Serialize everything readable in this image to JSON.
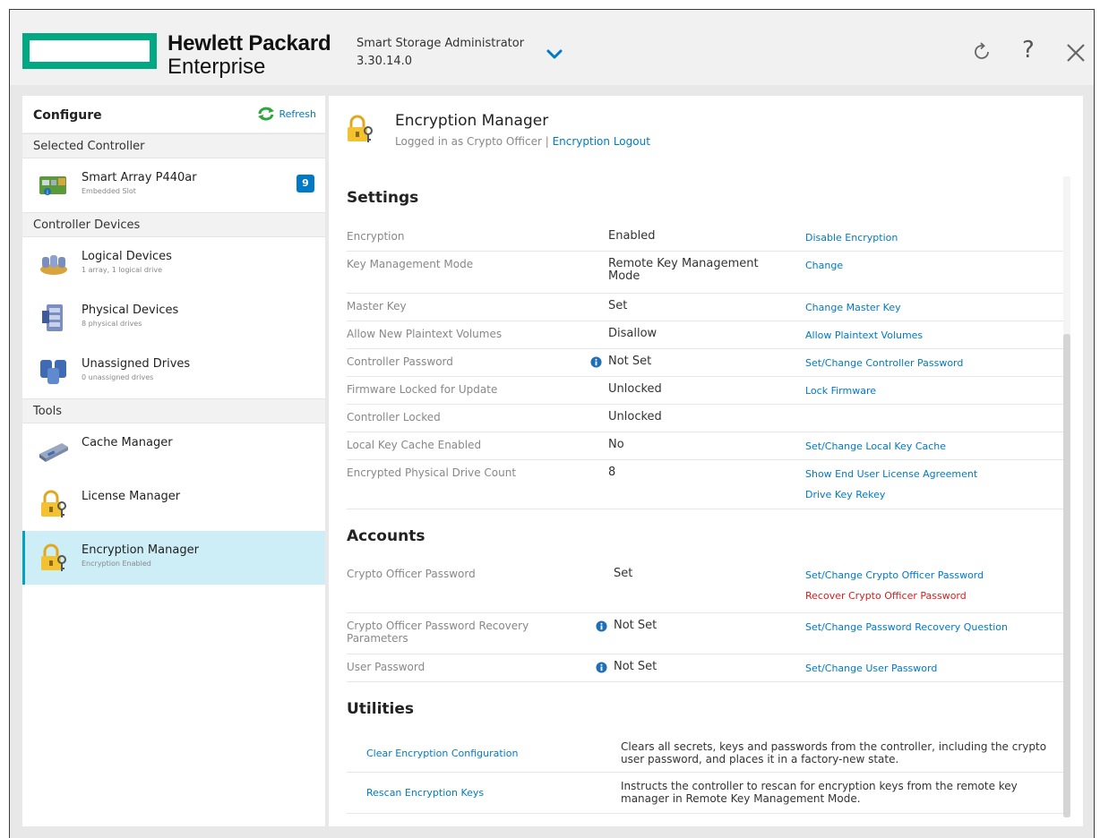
{
  "header": {
    "brand_line1": "Hewlett Packard",
    "brand_line2": "Enterprise",
    "app_name": "Smart Storage Administrator",
    "app_version": "3.30.14.0",
    "help_glyph": "?"
  },
  "colors": {
    "brand_green": "#01a982",
    "link_blue": "#0079c7",
    "danger_red": "#e01a1a",
    "selected_bg": "#cdeef7"
  },
  "sidebar": {
    "configure_label": "Configure",
    "refresh_label": "Refresh",
    "selected_controller_header": "Selected Controller",
    "controller": {
      "name": "Smart Array P440ar",
      "slot": "Embedded Slot",
      "badge": "9",
      "icon": "controller-icon"
    },
    "devices_header": "Controller Devices",
    "devices": [
      {
        "title": "Logical Devices",
        "sub": "1 array, 1 logical drive",
        "icon": "logical-devices-icon"
      },
      {
        "title": "Physical Devices",
        "sub": "8 physical drives",
        "icon": "physical-devices-icon"
      },
      {
        "title": "Unassigned Drives",
        "sub": "0 unassigned drives",
        "icon": "unassigned-drives-icon"
      }
    ],
    "tools_header": "Tools",
    "tools": [
      {
        "title": "Cache Manager",
        "sub": "",
        "icon": "cache-manager-icon"
      },
      {
        "title": "License Manager",
        "sub": "",
        "icon": "key-lock-icon"
      },
      {
        "title": "Encryption Manager",
        "sub": "Encryption Enabled",
        "icon": "key-lock-icon",
        "selected": true
      }
    ]
  },
  "main": {
    "title": "Encryption Manager",
    "logged_in_text": "Logged in as Crypto Officer |",
    "logout_link": "Encryption Logout",
    "settings_title": "Settings",
    "settings": [
      {
        "label": "Encryption",
        "value": "Enabled",
        "actions": [
          "Disable Encryption"
        ]
      },
      {
        "label": "Key Management Mode",
        "value": "Remote Key Management Mode",
        "actions": [
          "Change"
        ]
      },
      {
        "label": "Master Key",
        "value": "Set",
        "actions": [
          "Change Master Key"
        ]
      },
      {
        "label": "Allow New Plaintext Volumes",
        "value": "Disallow",
        "actions": [
          "Allow Plaintext Volumes"
        ]
      },
      {
        "label": "Controller Password",
        "value": "Not Set",
        "info": true,
        "actions": [
          "Set/Change Controller Password"
        ]
      },
      {
        "label": "Firmware Locked for Update",
        "value": "Unlocked",
        "actions": [
          "Lock Firmware"
        ]
      },
      {
        "label": "Controller Locked",
        "value": "Unlocked",
        "actions": []
      },
      {
        "label": "Local Key Cache Enabled",
        "value": "No",
        "actions": [
          "Set/Change Local Key Cache"
        ]
      },
      {
        "label": "Encrypted Physical Drive Count",
        "value": "8",
        "actions": [
          "Show End User License Agreement",
          "Drive Key Rekey"
        ]
      }
    ],
    "accounts_title": "Accounts",
    "accounts": [
      {
        "label": "Crypto Officer Password",
        "value": "Set",
        "actions": [
          "Set/Change Crypto Officer Password"
        ],
        "danger_action": "Recover Crypto Officer Password"
      },
      {
        "label": "Crypto Officer Password Recovery Parameters",
        "value": "Not Set",
        "info": true,
        "actions": [
          "Set/Change Password Recovery Question"
        ]
      },
      {
        "label": "User Password",
        "value": "Not Set",
        "info": true,
        "actions": [
          "Set/Change User Password"
        ]
      }
    ],
    "utilities_title": "Utilities",
    "utilities": [
      {
        "link": "Clear Encryption Configuration",
        "desc": "Clears all secrets, keys and passwords from the controller, including the crypto user password, and places it in a factory-new state."
      },
      {
        "link": "Rescan Encryption Keys",
        "desc": "Instructs the controller to rescan for encryption keys from the remote key manager in Remote Key Management Mode."
      }
    ]
  }
}
